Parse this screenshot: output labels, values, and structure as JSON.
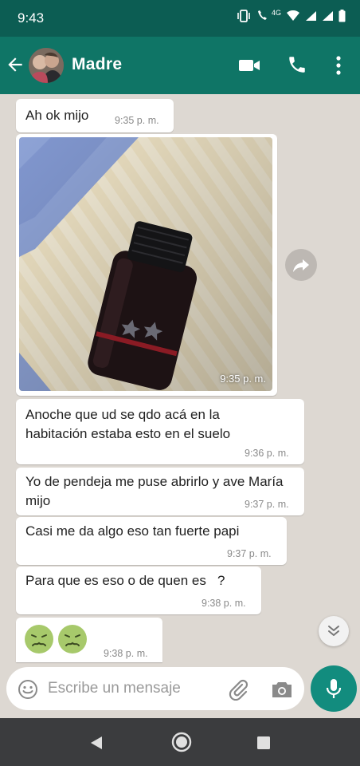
{
  "status_bar": {
    "time": "9:43",
    "network": "4G"
  },
  "header": {
    "contact_name": "Madre"
  },
  "messages": [
    {
      "text": "Ah ok mijo",
      "time": "9:35 p. m."
    },
    {
      "type": "image",
      "time": "9:35 p. m."
    },
    {
      "text": "Anoche que ud se qdo acá en la habitación estaba esto en el suelo",
      "time": "9:36 p. m."
    },
    {
      "text": "Yo de pendeja me puse abrirlo y ave María mijo",
      "time": "9:37 p. m."
    },
    {
      "text": "Casi me da algo eso tan fuerte papi",
      "time": "9:37 p. m."
    },
    {
      "text": "Para que es eso o de quen es   ?",
      "time": "9:38 p. m."
    },
    {
      "text": "🤢🤢",
      "time": "9:38 p. m."
    }
  ],
  "composer": {
    "placeholder": "Escribe un mensaje"
  },
  "colors": {
    "header": "#0f7566",
    "status_bar": "#0c5d53",
    "chat_bg": "#ddd8d2",
    "mic": "#128c7e",
    "nav_bar": "#3b3c3e"
  },
  "icons": {
    "back": "arrow-left-icon",
    "video": "video-camera-icon",
    "call": "phone-icon",
    "more": "more-vert-icon",
    "forward": "forward-icon",
    "scroll": "chevron-double-down-icon",
    "emoji": "emoji-icon",
    "attach": "paperclip-icon",
    "camera": "camera-icon",
    "mic": "microphone-icon"
  }
}
